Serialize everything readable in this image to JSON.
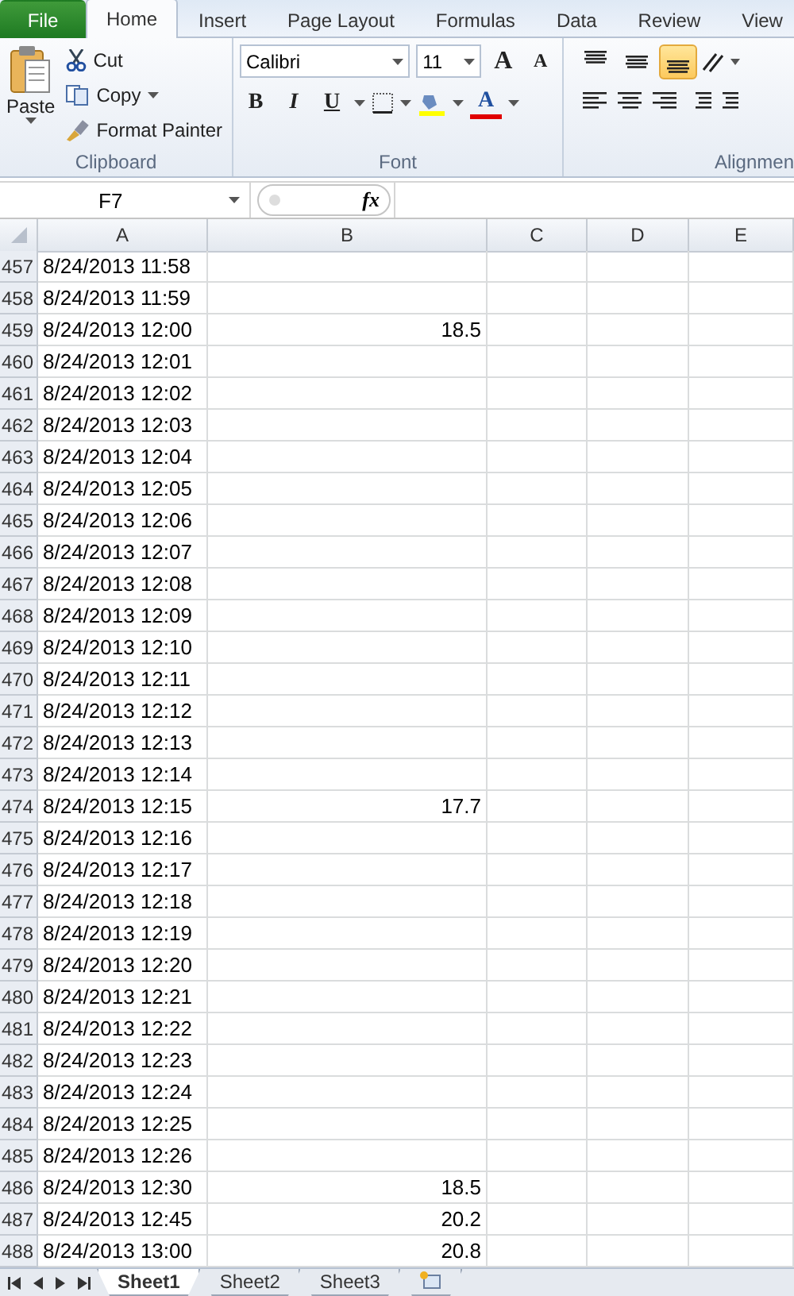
{
  "ribbon_tabs": [
    {
      "label": "File",
      "kind": "file",
      "selected": false
    },
    {
      "label": "Home",
      "kind": "tab",
      "selected": true
    },
    {
      "label": "Insert",
      "kind": "tab",
      "selected": false
    },
    {
      "label": "Page Layout",
      "kind": "tab",
      "selected": false
    },
    {
      "label": "Formulas",
      "kind": "tab",
      "selected": false
    },
    {
      "label": "Data",
      "kind": "tab",
      "selected": false
    },
    {
      "label": "Review",
      "kind": "tab",
      "selected": false
    },
    {
      "label": "View",
      "kind": "tab",
      "selected": false
    }
  ],
  "clipboard": {
    "title": "Clipboard",
    "paste": "Paste",
    "cut": "Cut",
    "copy": "Copy",
    "format_painter": "Format Painter"
  },
  "font": {
    "title": "Font",
    "name": "Calibri",
    "size": "11",
    "bold": "B",
    "italic": "I",
    "underline": "U",
    "font_color": "A",
    "grow": "A",
    "shrink": "A"
  },
  "alignment": {
    "title": "Alignmen",
    "vertical": [
      {
        "kind": "top",
        "selected": false
      },
      {
        "kind": "middle",
        "selected": false
      },
      {
        "kind": "bottom",
        "selected": true
      }
    ]
  },
  "formula_bar": {
    "name_box": "F7",
    "fx": "fx"
  },
  "columns": [
    {
      "label": "A"
    },
    {
      "label": "B"
    },
    {
      "label": "C"
    },
    {
      "label": "D"
    },
    {
      "label": "E"
    }
  ],
  "rows": [
    {
      "n": "457",
      "a": "8/24/2013 11:58"
    },
    {
      "n": "458",
      "a": "8/24/2013 11:59"
    },
    {
      "n": "459",
      "a": "8/24/2013 12:00",
      "b": "18.5"
    },
    {
      "n": "460",
      "a": "8/24/2013 12:01"
    },
    {
      "n": "461",
      "a": "8/24/2013 12:02"
    },
    {
      "n": "462",
      "a": "8/24/2013 12:03"
    },
    {
      "n": "463",
      "a": "8/24/2013 12:04"
    },
    {
      "n": "464",
      "a": "8/24/2013 12:05"
    },
    {
      "n": "465",
      "a": "8/24/2013 12:06"
    },
    {
      "n": "466",
      "a": "8/24/2013 12:07"
    },
    {
      "n": "467",
      "a": "8/24/2013 12:08"
    },
    {
      "n": "468",
      "a": "8/24/2013 12:09"
    },
    {
      "n": "469",
      "a": "8/24/2013 12:10"
    },
    {
      "n": "470",
      "a": "8/24/2013 12:11"
    },
    {
      "n": "471",
      "a": "8/24/2013 12:12"
    },
    {
      "n": "472",
      "a": "8/24/2013 12:13"
    },
    {
      "n": "473",
      "a": "8/24/2013 12:14"
    },
    {
      "n": "474",
      "a": "8/24/2013 12:15",
      "b": "17.7"
    },
    {
      "n": "475",
      "a": "8/24/2013 12:16"
    },
    {
      "n": "476",
      "a": "8/24/2013 12:17"
    },
    {
      "n": "477",
      "a": "8/24/2013 12:18"
    },
    {
      "n": "478",
      "a": "8/24/2013 12:19"
    },
    {
      "n": "479",
      "a": "8/24/2013 12:20"
    },
    {
      "n": "480",
      "a": "8/24/2013 12:21"
    },
    {
      "n": "481",
      "a": "8/24/2013 12:22"
    },
    {
      "n": "482",
      "a": "8/24/2013 12:23"
    },
    {
      "n": "483",
      "a": "8/24/2013 12:24"
    },
    {
      "n": "484",
      "a": "8/24/2013 12:25"
    },
    {
      "n": "485",
      "a": "8/24/2013 12:26"
    },
    {
      "n": "486",
      "a": "8/24/2013 12:30",
      "b": "18.5"
    },
    {
      "n": "487",
      "a": "8/24/2013 12:45",
      "b": "20.2"
    },
    {
      "n": "488",
      "a": "8/24/2013 13:00",
      "b": "20.8"
    }
  ],
  "sheets": [
    {
      "label": "Sheet1",
      "selected": true
    },
    {
      "label": "Sheet2",
      "selected": false
    },
    {
      "label": "Sheet3",
      "selected": false
    }
  ]
}
